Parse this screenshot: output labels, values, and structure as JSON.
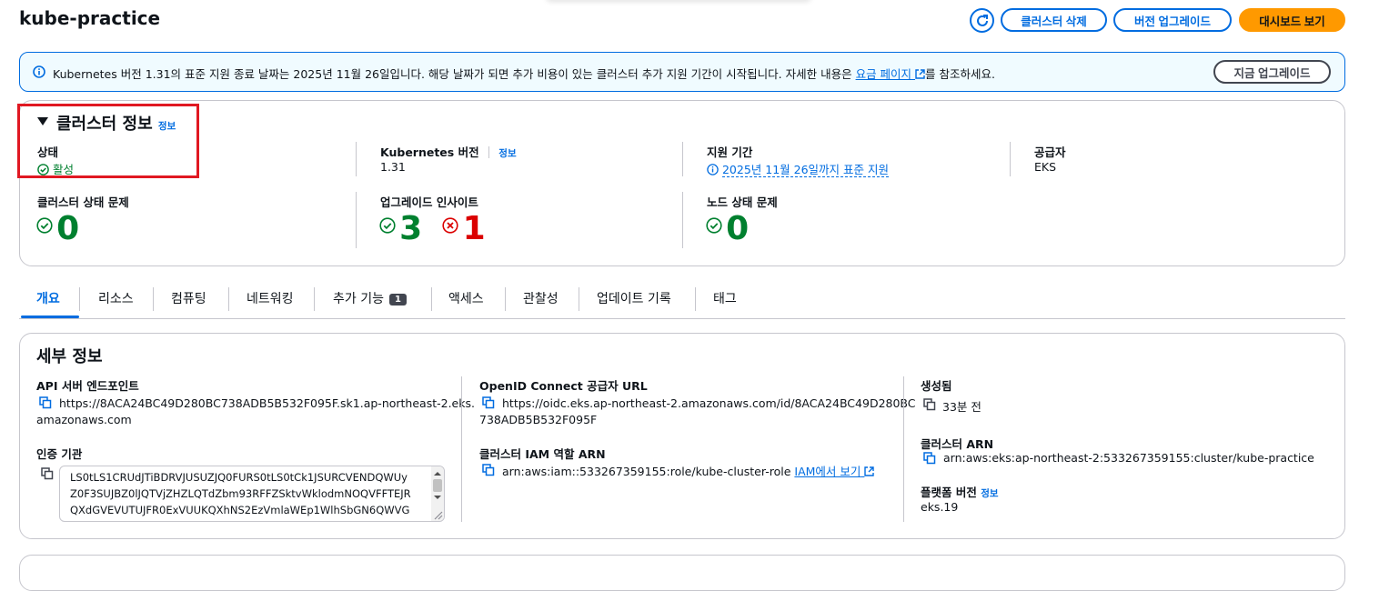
{
  "page": {
    "title": "kube-practice"
  },
  "header_buttons": {
    "refresh_icon": "refresh-icon",
    "delete": "클러스터 삭제",
    "upgrade": "버전 업그레이드",
    "dashboard": "대시보드 보기"
  },
  "alert": {
    "text_before": "Kubernetes 버전 1.31의 표준 지원 종료 날짜는 2025년 11월 26일입니다. 해당 날짜가 되면 추가 비용이 있는 클러스터 추가 지원 기간이 시작됩니다. 자세한 내용은 ",
    "link": "요금 페이지",
    "text_after": "를 참조하세요.",
    "button": "지금 업그레이드"
  },
  "cluster_info": {
    "title": "클러스터 정보",
    "info": "정보",
    "status_label": "상태",
    "status_value": "활성",
    "k8s_label": "Kubernetes 버전",
    "k8s_info": "정보",
    "k8s_value": "1.31",
    "support_label": "지원 기간",
    "support_value": "2025년 11월 26일까지 표준 지원",
    "provider_label": "공급자",
    "provider_value": "EKS",
    "health_label": "클러스터 상태 문제",
    "health_value": "0",
    "insights_label": "업그레이드 인사이트",
    "insights_pass": "3",
    "insights_fail": "1",
    "node_label": "노드 상태 문제",
    "node_value": "0"
  },
  "tabs": [
    {
      "label": "개요",
      "active": true
    },
    {
      "label": "리소스"
    },
    {
      "label": "컴퓨팅"
    },
    {
      "label": "네트워킹"
    },
    {
      "label": "추가 기능",
      "badge": "1"
    },
    {
      "label": "액세스"
    },
    {
      "label": "관찰성"
    },
    {
      "label": "업데이트 기록"
    },
    {
      "label": "태그"
    }
  ],
  "details": {
    "title": "세부 정보",
    "api_label": "API 서버 엔드포인트",
    "api_line1": "https://8ACA24BC49D280BC738ADB5B532F095F.sk1.ap-northeast-2.eks.",
    "api_line2": "amazonaws.com",
    "ca_label": "인증 기관",
    "ca_lines": [
      "LS0tLS1CRUdJTiBDRVJUSUZJQ0FURS0tLS0tCk1JSURCVENDQWUy",
      "Z0F3SUJBZ0lJQTVjZHZLQTdZbm93RFFZSktvWklodmNOQVFFTEJR",
      "QXdGVEVUTUJFR0ExVUUKQXhNS2EzVmlaWEp1WlhSbGN6QWVG"
    ],
    "oidc_label": "OpenID Connect 공급자 URL",
    "oidc_line1": "https://oidc.eks.ap-northeast-2.amazonaws.com/id/8ACA24BC49D280BC",
    "oidc_line2": "738ADB5B532F095F",
    "iam_label": "클러스터 IAM 역할 ARN",
    "iam_value": "arn:aws:iam::533267359155:role/kube-cluster-role",
    "iam_link": "IAM에서 보기",
    "created_label": "생성됨",
    "created_value": "33분 전",
    "arn_label": "클러스터 ARN",
    "arn_value": "arn:aws:eks:ap-northeast-2:533267359155:cluster/kube-practice",
    "platform_label": "플랫폼 버전",
    "platform_info": "정보",
    "platform_value": "eks.19"
  },
  "colors": {
    "accent": "#006ce0",
    "primary_button": "#ff9900",
    "success": "#00802f",
    "error": "#db0000",
    "highlight_box": "#e01822"
  }
}
